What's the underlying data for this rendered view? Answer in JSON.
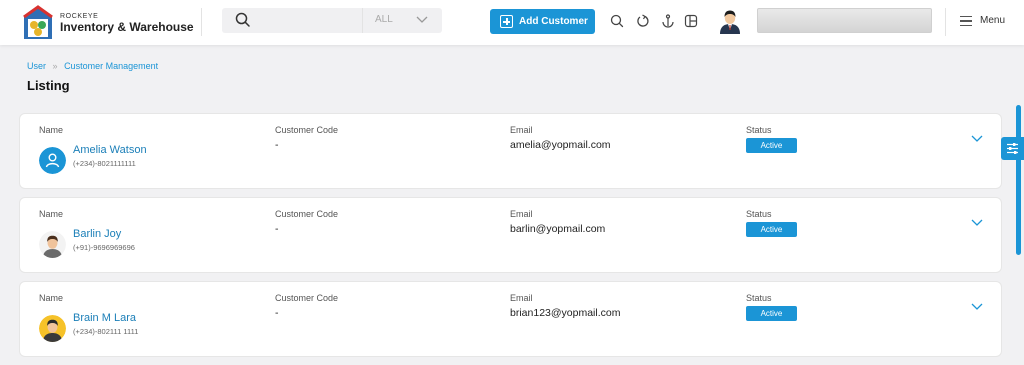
{
  "brand": {
    "tagline": "ROCKEYE",
    "name": "Inventory & Warehouse"
  },
  "search": {
    "placeholder": "",
    "filter_value": "ALL"
  },
  "header": {
    "add_button_label": "Add Customer",
    "menu_label": "Menu"
  },
  "breadcrumb": {
    "items": [
      "User",
      "Customer Management"
    ]
  },
  "page": {
    "title": "Listing"
  },
  "columns": {
    "name": "Name",
    "code": "Customer Code",
    "email": "Email",
    "status": "Status"
  },
  "customers": [
    {
      "name": "Amelia Watson",
      "phone": "(+234)-8021111111",
      "code": "-",
      "email": "amelia@yopmail.com",
      "status": "Active",
      "avatar": "default-user-icon"
    },
    {
      "name": "Barlin Joy",
      "phone": "(+91)-9696969696",
      "code": "-",
      "email": "barlin@yopmail.com",
      "status": "Active",
      "avatar": "photo-male"
    },
    {
      "name": "Brain M Lara",
      "phone": "(+234)-802111 1111",
      "code": "-",
      "email": "brian123@yopmail.com",
      "status": "Active",
      "avatar": "photo-male-yellow"
    }
  ],
  "colors": {
    "accent": "#1b95d6",
    "link": "#1b7fb8",
    "background": "#f1f1f3"
  }
}
